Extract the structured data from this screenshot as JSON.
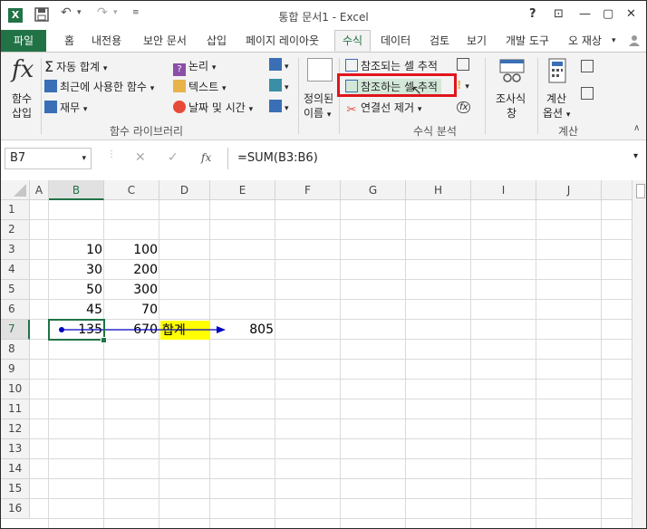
{
  "title_bar": {
    "app_icon": "X",
    "title": "통합 문서1 - Excel",
    "help": "?",
    "close": "✕",
    "minimize": "—",
    "restore": "▢",
    "ribbon_opts": "⊡"
  },
  "tabs": [
    "파일",
    "홈",
    "내전용",
    "보안 문서",
    "삽입",
    "페이지 레이아웃",
    "수식",
    "데이터",
    "검토",
    "보기",
    "개발 도구"
  ],
  "active_tab": "수식",
  "user": "오 재상",
  "ribbon": {
    "insert_function": {
      "icon": "fx",
      "label1": "함수",
      "label2": "삽입"
    },
    "library": {
      "autosum": "자동 합계",
      "recent": "최근에 사용한 함수",
      "financial": "재무",
      "logical": "논리",
      "text": "텍스트",
      "datetime": "날짜 및 시간",
      "group_label": "함수 라이브러리"
    },
    "defined_names": {
      "label1": "정의된",
      "label2": "이름"
    },
    "auditing": {
      "trace_precedents": "참조되는 셀 추적",
      "trace_dependents": "참조하는 셀 추적",
      "remove_arrows": "연결선 제거",
      "group_label": "수식 분석"
    },
    "watch": {
      "label1": "조사식",
      "label2": "창"
    },
    "calc": {
      "label1": "계산",
      "label2": "옵션",
      "group_label": "계산"
    }
  },
  "formula_bar": {
    "name_box": "B7",
    "cancel": "✕",
    "enter": "✓",
    "fx": "fx",
    "formula": "=SUM(B3:B6)"
  },
  "columns": [
    "A",
    "B",
    "C",
    "D",
    "E",
    "F",
    "G",
    "H",
    "I",
    "J"
  ],
  "rows": [
    "1",
    "2",
    "3",
    "4",
    "5",
    "6",
    "7",
    "8",
    "9",
    "10",
    "11",
    "12",
    "13",
    "14",
    "15",
    "16"
  ],
  "selected_cell": "B7",
  "cells": {
    "B3": "10",
    "C3": "100",
    "B4": "30",
    "C4": "200",
    "B5": "50",
    "C5": "300",
    "B6": "45",
    "C6": "70",
    "B7": "135",
    "C7": "670",
    "D7": "합계",
    "E7": "805"
  },
  "colors": {
    "excel_green": "#217346",
    "highlight_red": "#e2141c",
    "sum_label_fill": "#ffff00",
    "trace_arrow": "#0000c0"
  }
}
